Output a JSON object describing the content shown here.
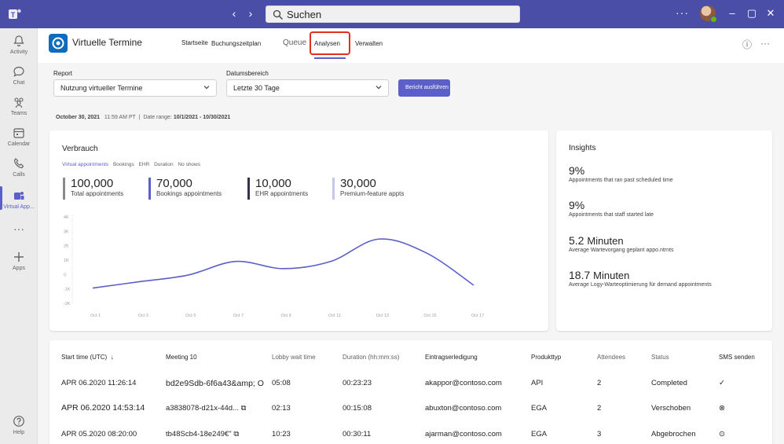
{
  "titlebar": {
    "search_text": "Suchen",
    "more": "···"
  },
  "rail": [
    {
      "label": "Activity",
      "icon": "bell-icon"
    },
    {
      "label": "Chat",
      "icon": "chat-icon"
    },
    {
      "label": "Teams",
      "icon": "teams-icon"
    },
    {
      "label": "Calendar",
      "icon": "calendar-icon"
    },
    {
      "label": "Calls",
      "icon": "phone-icon"
    },
    {
      "label": "Virtual App...",
      "icon": "virtual-appointments-icon"
    },
    {
      "label": "",
      "icon": "more-apps-icon"
    },
    {
      "label": "Apps",
      "icon": "plus-icon"
    },
    {
      "label": "Help",
      "icon": "help-icon"
    }
  ],
  "app": {
    "title": "Virtuelle Termine",
    "tabs": [
      "Startseite",
      "Buchungszeitplan",
      "Queue",
      "Analysen",
      "Verwalten"
    ]
  },
  "filters": {
    "report_label": "Report",
    "report_value": "Nutzung virtueller Termine",
    "range_label": "Datumsbereich",
    "range_value": "Letzte 30 Tage",
    "run_button": "Bericht ausführen"
  },
  "meta": {
    "date": "October 30, 2021",
    "time": "11:59 AM PT",
    "range_label": "Date range:",
    "range": "10/1/2021 - 10/30/2021"
  },
  "usage": {
    "title": "Verbrauch",
    "subtabs": [
      "Virtual appointments",
      "Bookings",
      "EHR",
      "Duration",
      "No shows"
    ],
    "stats": [
      {
        "value": "100,000",
        "label": "Total appointments",
        "color": "#8a8a8a"
      },
      {
        "value": "70,000",
        "label": "Bookings appointments",
        "color": "#5b5fc7"
      },
      {
        "value": "10,000",
        "label": "EHR appointments",
        "color": "#33344a"
      },
      {
        "value": "30,000",
        "label": "Premium-feature appts",
        "color": "#c5c7f1"
      }
    ]
  },
  "chart_data": {
    "type": "line",
    "title": "",
    "x": [
      "Oct 1",
      "Oct 3",
      "Oct 5",
      "Oct 7",
      "Oct 9",
      "Oct 11",
      "Oct 13",
      "Oct 15",
      "Oct 17"
    ],
    "y_ticks": [
      "4K",
      "3K",
      "2K",
      "1K",
      "0",
      "-1K",
      "-2K"
    ],
    "series": [
      {
        "values": [
          -1050,
          -600,
          -150,
          800,
          300,
          800,
          2350,
          1400,
          -850
        ],
        "color": "#5b5fc7"
      }
    ],
    "ylim": [
      -2000,
      4000
    ],
    "grid": false
  },
  "insights": {
    "title": "Insights",
    "items": [
      {
        "value": "9%",
        "unit": "",
        "text": "Appointments that ran past scheduled time"
      },
      {
        "value": "9%",
        "unit": "",
        "text": "Appointments that staff started late"
      },
      {
        "value": "5.2",
        "unit": "Minuten",
        "text": "Average Wartevorgang geplant appo.ntrnts"
      },
      {
        "value": "18.7",
        "unit": "Minuten",
        "text": "Average Logy-Warteoptimierung für demand appointments"
      }
    ]
  },
  "table": {
    "headers": [
      "Start time (UTC)",
      "Meeting 10",
      "Lobby wait time",
      "Duration (hh:mm:ss)",
      "Eintragserledigung",
      "Produkttyp",
      "Attendees",
      "Status",
      "SMS senden"
    ],
    "sort_icon": "↓",
    "rows": [
      {
        "start": "APR 06.2020 11:26:14",
        "meeting": "bd2e9Sdb-6f6a43&amp; O",
        "lobby": "05:08",
        "duration": "00:23:23",
        "email": "akappor@contoso.com",
        "product": "API",
        "attendees": "2",
        "status": "Completed",
        "sms": "✓"
      },
      {
        "start": "APR 06.2020 14:53:14",
        "meeting": "a3838078-d21x-44d...",
        "lobby": "02:13",
        "duration": "00:15:08",
        "email": "abuxton@contoso.com",
        "product": "EGA",
        "attendees": "2",
        "status": "Verschoben",
        "sms": "⊗"
      },
      {
        "start": "APR 05.2020 08:20:00",
        "meeting": "tb48Scb4-18e249€\"",
        "lobby": "10:23",
        "duration": "00:30:11",
        "email": "ajarman@contoso.com",
        "product": "EGA",
        "attendees": "3",
        "status": "Abgebrochen",
        "sms": "⊙"
      }
    ]
  }
}
